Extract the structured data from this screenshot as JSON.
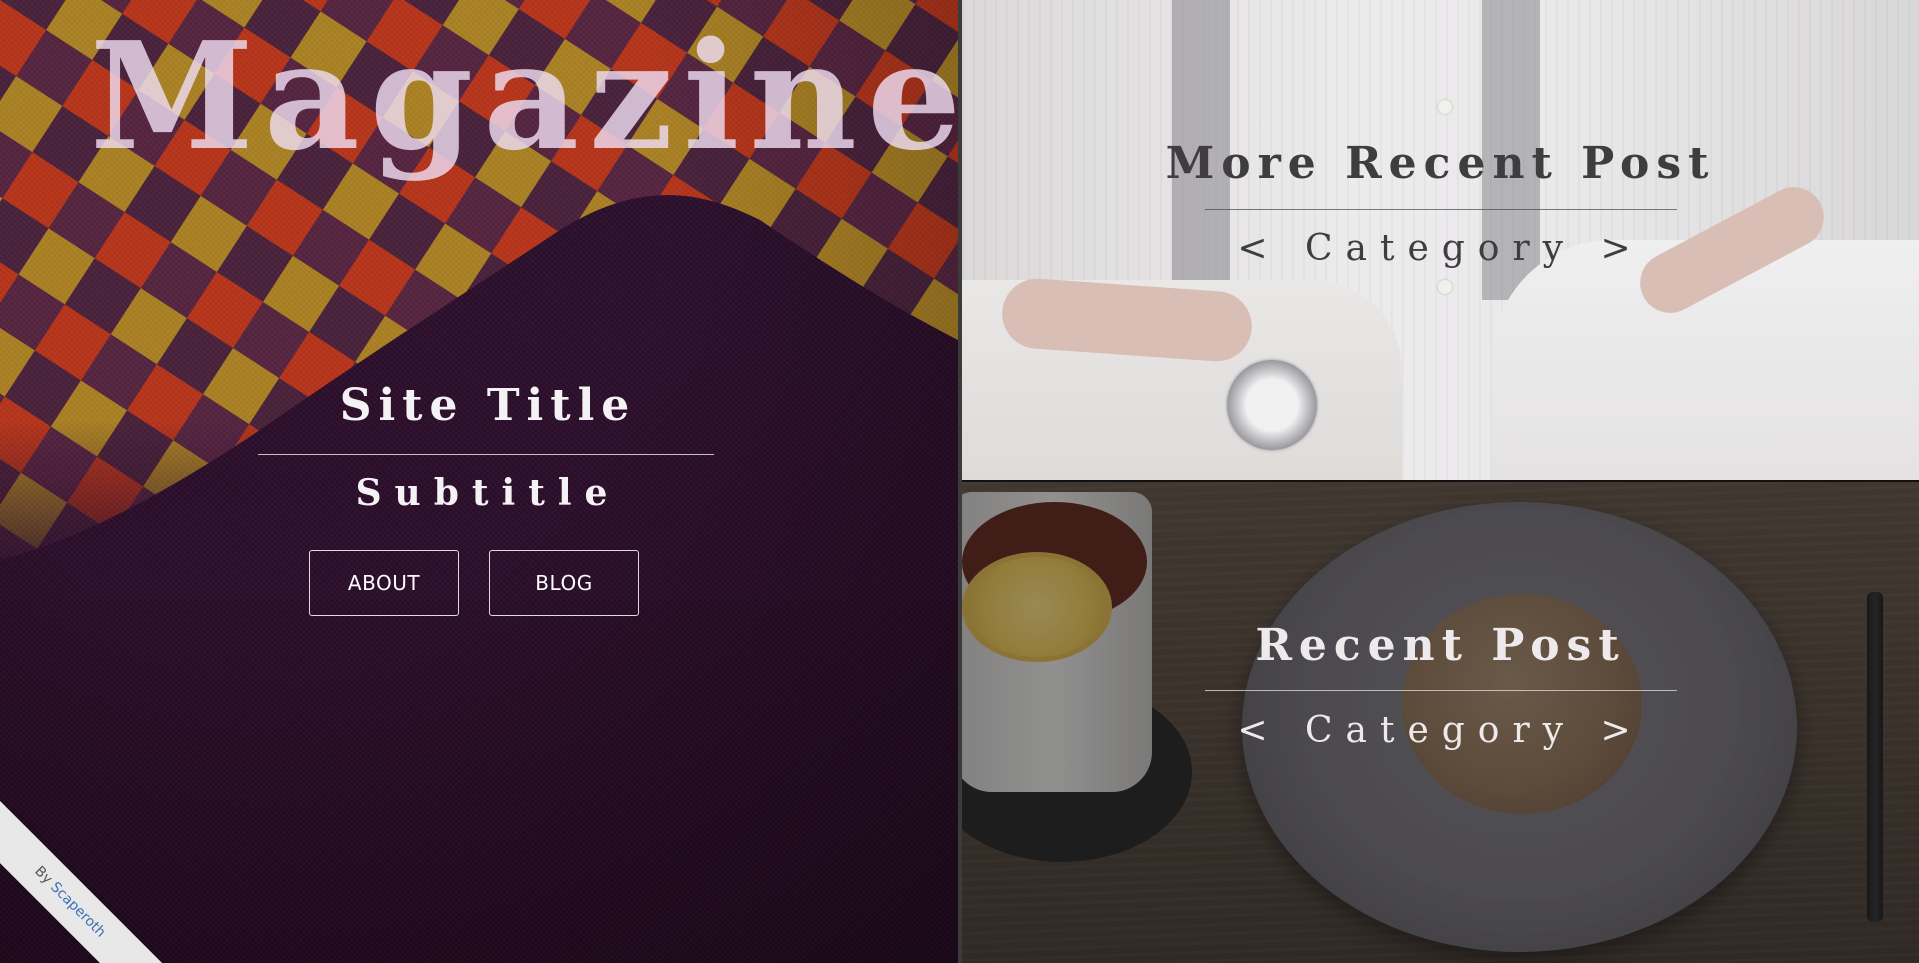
{
  "hero": {
    "brand": "Magazine",
    "site_title": "Site Title",
    "subtitle": "Subtitle",
    "buttons": {
      "about": "ABOUT",
      "blog": "BLOG"
    }
  },
  "credit": {
    "prefix": "By",
    "author": "Scaperoth"
  },
  "posts": [
    {
      "title": "More Recent Post",
      "category": "< Category >",
      "image": "man-shirt-watch-photo",
      "text_color": "#3f3d40"
    },
    {
      "title": "Recent Post",
      "category": "< Category >",
      "image": "tea-pastry-plate-photo",
      "text_color": "#eeeaec"
    }
  ],
  "colors": {
    "left_background": "#2b0d2a",
    "divider": "#3b3b3b",
    "ribbon": "#e8e8e8",
    "author_link": "#3a6fb5"
  }
}
